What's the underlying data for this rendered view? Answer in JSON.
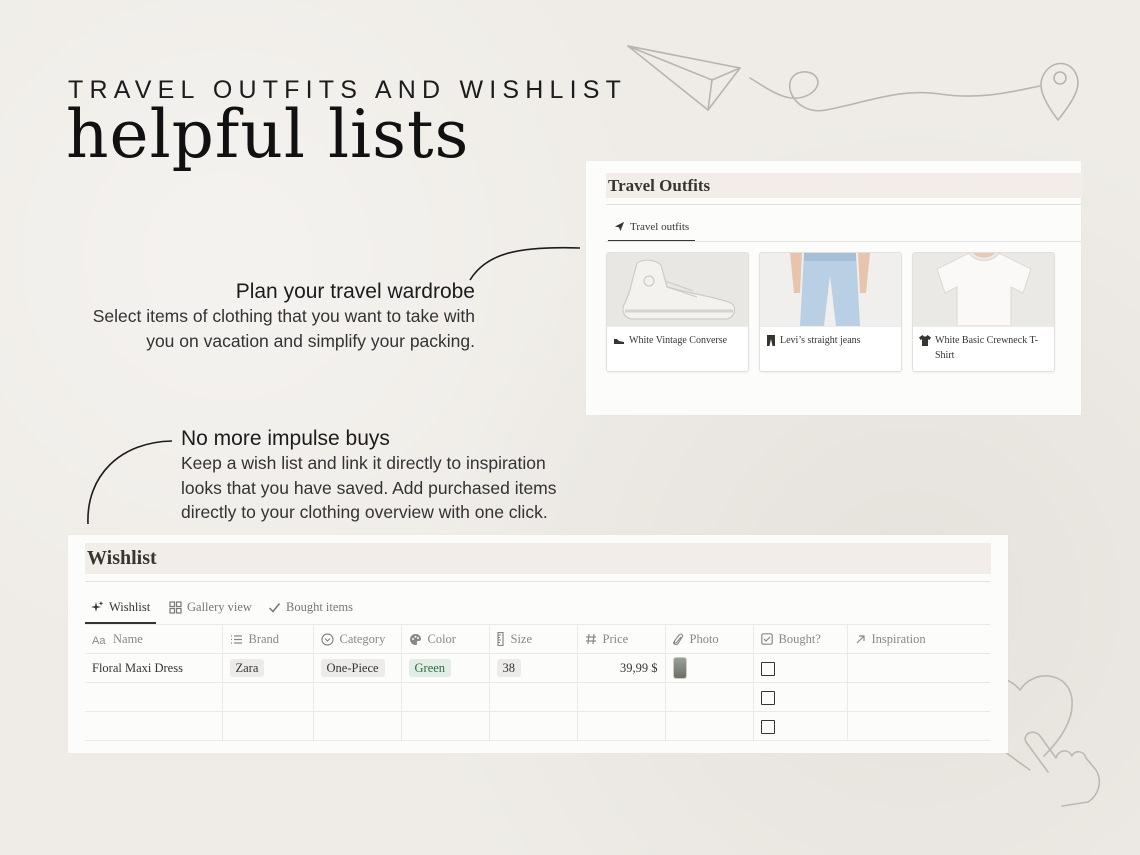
{
  "header": {
    "kicker": "TRAVEL OUTFITS AND WISHLIST",
    "headline": "helpful lists"
  },
  "callouts": {
    "plan": {
      "title": "Plan your travel wardrobe",
      "body": "Select items of clothing that you want to take with you on vacation and simplify your packing."
    },
    "impulse": {
      "title": "No more impulse buys",
      "body": "Keep a wish list and link it directly to inspiration looks that you have saved. Add purchased items directly to your clothing overview with one click."
    }
  },
  "travel": {
    "title": "Travel Outfits",
    "tab_label": "Travel outfits",
    "cards": [
      {
        "label": "White Vintage Converse",
        "icon": "shoe-icon"
      },
      {
        "label": "Levi’s straight jeans",
        "icon": "pants-icon"
      },
      {
        "label": "White Basic Crewneck T-Shirt",
        "icon": "shirt-icon"
      }
    ]
  },
  "wishlist": {
    "title": "Wishlist",
    "tabs": [
      {
        "label": "Wishlist",
        "icon": "sparkle-icon",
        "active": true
      },
      {
        "label": "Gallery view",
        "icon": "gallery-icon",
        "active": false
      },
      {
        "label": "Bought items",
        "icon": "check-icon",
        "active": false
      }
    ],
    "columns": [
      {
        "label": "Name",
        "icon": "text-icon"
      },
      {
        "label": "Brand",
        "icon": "list-icon"
      },
      {
        "label": "Category",
        "icon": "select-icon"
      },
      {
        "label": "Color",
        "icon": "palette-icon"
      },
      {
        "label": "Size",
        "icon": "ruler-icon"
      },
      {
        "label": "Price",
        "icon": "hash-icon"
      },
      {
        "label": "Photo",
        "icon": "paperclip-icon"
      },
      {
        "label": "Bought?",
        "icon": "checkbox-icon"
      },
      {
        "label": "Inspiration",
        "icon": "arrow-icon"
      }
    ],
    "rows": [
      {
        "name": "Floral Maxi Dress",
        "brand": "Zara",
        "category": "One-Piece",
        "color": "Green",
        "size": "38",
        "price": "39,99 $",
        "has_photo": true,
        "bought": false,
        "inspiration": ""
      },
      {
        "name": "",
        "brand": "",
        "category": "",
        "color": "",
        "size": "",
        "price": "",
        "has_photo": false,
        "bought": false,
        "inspiration": ""
      },
      {
        "name": "",
        "brand": "",
        "category": "",
        "color": "",
        "size": "",
        "price": "",
        "has_photo": false,
        "bought": false,
        "inspiration": ""
      }
    ]
  },
  "colors": {
    "background": "#efece7",
    "title_bar": "#f2ede9",
    "green_tag_bg": "#e2ede5",
    "green_tag_text": "#2f6b43",
    "line_art": "#b9b4ad"
  }
}
